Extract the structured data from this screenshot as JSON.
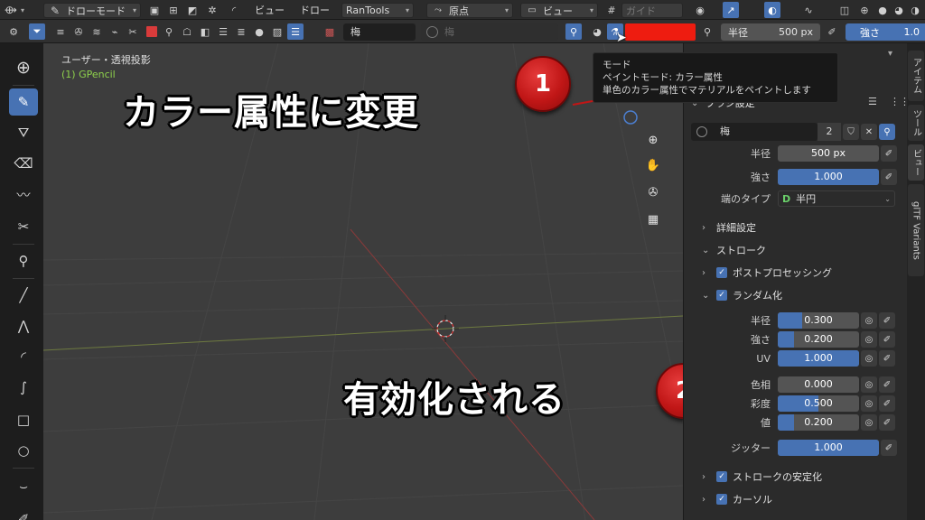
{
  "header1": {
    "mode_label": "ドローモード",
    "menu_view": "ビュー",
    "menu_draw": "ドロー",
    "addon_label": "RanTools",
    "origin_label": "原点",
    "view_label": "ビュー",
    "guide_label": "ガイド"
  },
  "header2": {
    "material_name": "梅",
    "material_ghost": "梅",
    "color_hex": "#ee1c10",
    "radius_label": "半径",
    "radius_value": "500 px",
    "strength_label": "強さ",
    "strength_value": "1.0"
  },
  "viewport": {
    "view_name": "ユーザー・透視投影",
    "object_name": "(1) GPencil",
    "annotation_1": "カラー属性に変更",
    "annotation_2": "有効化される",
    "marker_1": "1",
    "marker_2": "2"
  },
  "tooltip": {
    "title": "モード",
    "line1": "ペイントモード: カラー属性",
    "line2": "単色のカラー属性でマテリアルをペイントします"
  },
  "panel": {
    "brush_section": "ブラシ設定",
    "brush_name": "梅",
    "brush_users": "2",
    "radius_label": "半径",
    "radius_value": "500 px",
    "strength_label": "強さ",
    "strength_value": "1.000",
    "strength_fill": 1.0,
    "caps_label": "端のタイプ",
    "caps_value": "半円",
    "advanced_label": "詳細設定",
    "stroke_label": "ストローク",
    "post_label": "ポストプロセッシング",
    "random_label": "ランダム化",
    "rand_radius_label": "半径",
    "rand_radius_value": "0.300",
    "rand_radius_fill": 0.3,
    "rand_strength_label": "強さ",
    "rand_strength_value": "0.200",
    "rand_strength_fill": 0.2,
    "uv_label": "UV",
    "uv_value": "1.000",
    "uv_fill": 1.0,
    "hue_label": "色相",
    "hue_value": "0.000",
    "hue_fill": 0.0,
    "sat_label": "彩度",
    "sat_value": "0.500",
    "sat_fill": 0.5,
    "val_label": "値",
    "val_value": "0.200",
    "val_fill": 0.2,
    "jitter_label": "ジッター",
    "jitter_value": "1.000",
    "jitter_fill": 1.0,
    "stabilize_label": "ストロークの安定化",
    "cursor_label": "カーソル"
  },
  "sidetabs": [
    "アイテム",
    "ツール",
    "ビュー",
    "glTF Variants"
  ],
  "colors": {
    "accent": "#4772b3",
    "marker": "#c01616",
    "paint": "#ee1c10"
  }
}
